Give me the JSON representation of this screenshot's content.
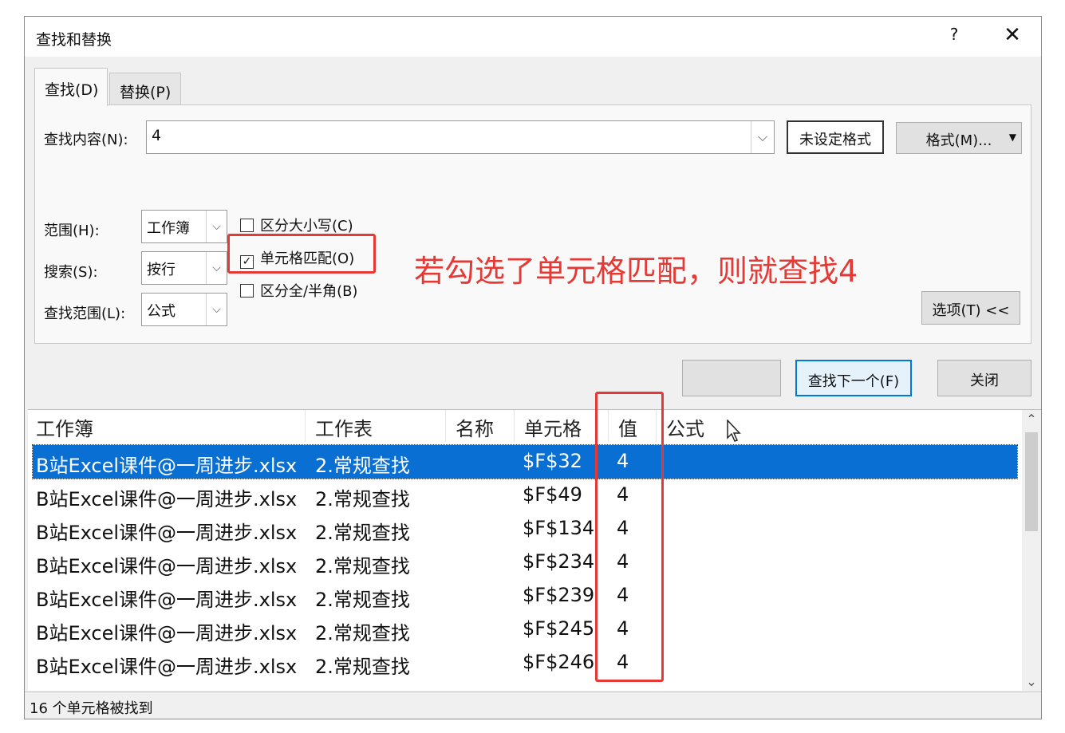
{
  "window": {
    "title": "查找和替换",
    "help": "?",
    "close": "✕"
  },
  "tabs": [
    {
      "label": "查找(D)"
    },
    {
      "label": "替换(P)"
    }
  ],
  "find": {
    "label": "查找内容(N):",
    "value": "4",
    "format_preview": "未设定格式",
    "format_button": "格式(M)...",
    "format_arrow": "▼"
  },
  "options": {
    "scope": {
      "label": "范围(H):",
      "value": "工作簿"
    },
    "search": {
      "label": "搜索(S):",
      "value": "按行"
    },
    "lookin": {
      "label": "查找范围(L):",
      "value": "公式"
    },
    "match_case": {
      "label": "区分大小写(C)",
      "checked": false
    },
    "match_cell": {
      "label": "单元格匹配(O)",
      "checked": true,
      "check_glyph": "✓"
    },
    "match_width": {
      "label": "区分全/半角(B)",
      "checked": false
    },
    "options_button": "选项(T) <<"
  },
  "actions": {
    "find_all": "",
    "find_next": "查找下一个(F)",
    "close": "关闭"
  },
  "annotation": {
    "text": "若勾选了单元格匹配，则就查找4",
    "color": "#e53935"
  },
  "results": {
    "columns": [
      "工作簿",
      "工作表",
      "名称",
      "单元格",
      "值",
      "公式"
    ],
    "rows": [
      {
        "book": "B站Excel课件@一周进步.xlsx",
        "sheet": "2.常规查找",
        "name": "",
        "cell": "$F$32",
        "value": "4",
        "formula": ""
      },
      {
        "book": "B站Excel课件@一周进步.xlsx",
        "sheet": "2.常规查找",
        "name": "",
        "cell": "$F$49",
        "value": "4",
        "formula": ""
      },
      {
        "book": "B站Excel课件@一周进步.xlsx",
        "sheet": "2.常规查找",
        "name": "",
        "cell": "$F$134",
        "value": "4",
        "formula": ""
      },
      {
        "book": "B站Excel课件@一周进步.xlsx",
        "sheet": "2.常规查找",
        "name": "",
        "cell": "$F$234",
        "value": "4",
        "formula": ""
      },
      {
        "book": "B站Excel课件@一周进步.xlsx",
        "sheet": "2.常规查找",
        "name": "",
        "cell": "$F$239",
        "value": "4",
        "formula": ""
      },
      {
        "book": "B站Excel课件@一周进步.xlsx",
        "sheet": "2.常规查找",
        "name": "",
        "cell": "$F$245",
        "value": "4",
        "formula": ""
      },
      {
        "book": "B站Excel课件@一周进步.xlsx",
        "sheet": "2.常规查找",
        "name": "",
        "cell": "$F$246",
        "value": "4",
        "formula": ""
      }
    ]
  },
  "status": "16 个单元格被找到",
  "colors": {
    "selection": "#0a6fd3",
    "accent": "#0078d7",
    "annotation": "#e53935"
  },
  "icons": {
    "combo_arrow": "⌵",
    "scroll_up": "⌃",
    "scroll_down": "⌄"
  }
}
